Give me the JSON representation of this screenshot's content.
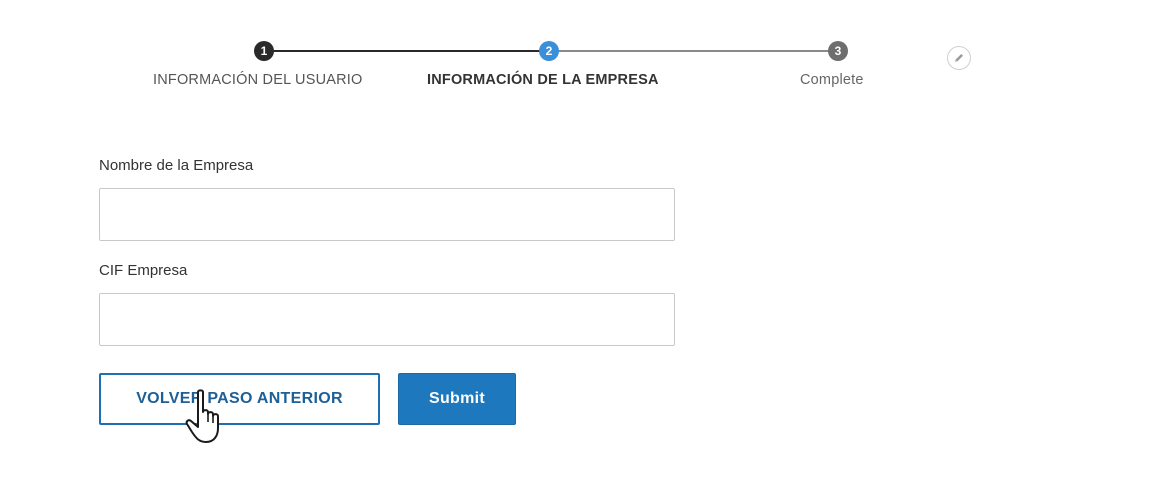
{
  "stepper": {
    "steps": [
      {
        "number": "1",
        "label": "INFORMACIÓN DEL USUARIO",
        "state": "completed"
      },
      {
        "number": "2",
        "label": "INFORMACIÓN DE LA EMPRESA",
        "state": "current"
      },
      {
        "number": "3",
        "label": "Complete",
        "state": "pending"
      }
    ],
    "colors": {
      "completed": "#2a2a2a",
      "current": "#3b8fd9",
      "pending": "#6e6e6e"
    },
    "edit_icon": "pencil-icon"
  },
  "form": {
    "company_name": {
      "label": "Nombre de la Empresa",
      "value": "",
      "placeholder": ""
    },
    "company_cif": {
      "label": "CIF Empresa",
      "value": "",
      "placeholder": ""
    }
  },
  "actions": {
    "back_label": "VOLVER PASO ANTERIOR",
    "submit_label": "Submit"
  },
  "cursor": {
    "icon": "hand-pointer-icon"
  }
}
